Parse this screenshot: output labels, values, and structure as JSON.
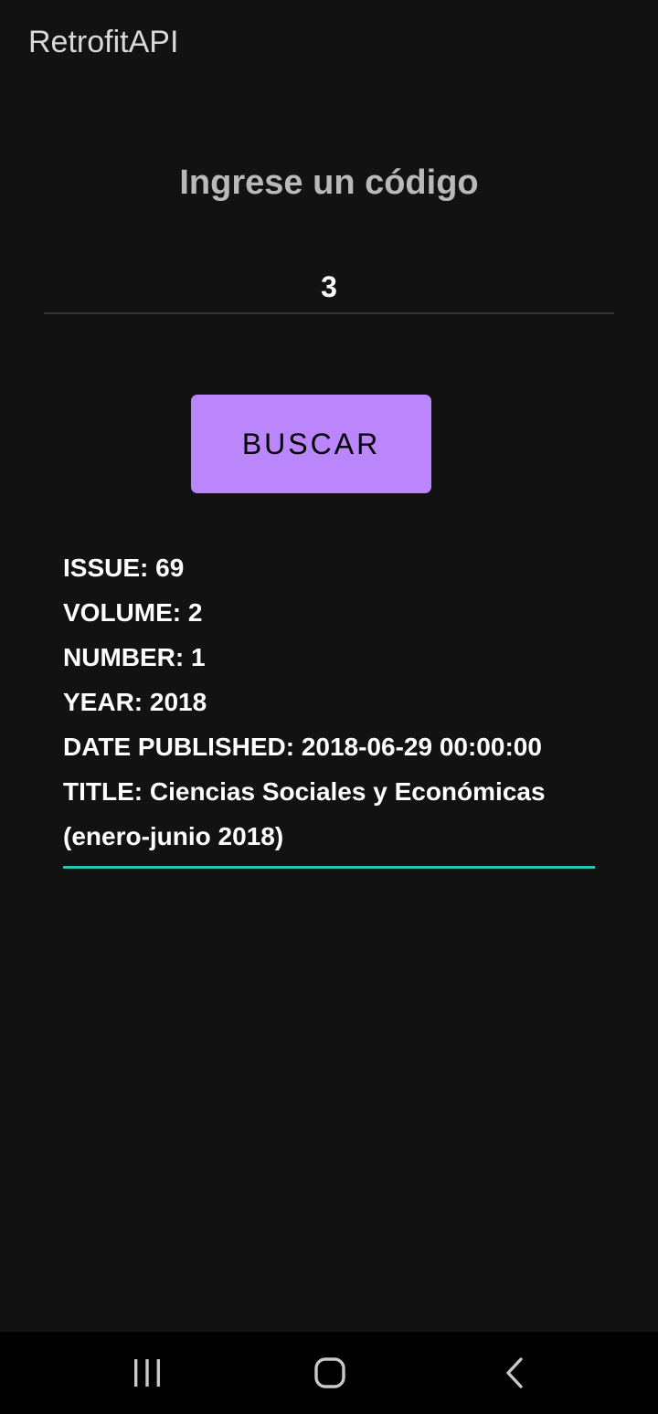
{
  "app": {
    "title": "RetrofitAPI"
  },
  "form": {
    "prompt": "Ingrese un código",
    "code_value": "3",
    "search_button_label": "BUSCAR"
  },
  "result": {
    "issue": "ISSUE: 69",
    "volume": "VOLUME: 2",
    "number": "NUMBER: 1",
    "year": "YEAR: 2018",
    "date_published": "DATE PUBLISHED: 2018-06-29 00:00:00",
    "title_line1": "TITLE: Ciencias Sociales y Económicas",
    "title_line2": "(enero-junio 2018)"
  },
  "navigation": {
    "icons": [
      "recent-apps-icon",
      "home-icon",
      "back-icon"
    ]
  },
  "colors": {
    "background": "#121212",
    "accent_button": "#bb86fc",
    "underline_accent": "#26c6b8",
    "nav_bar": "#000000"
  }
}
